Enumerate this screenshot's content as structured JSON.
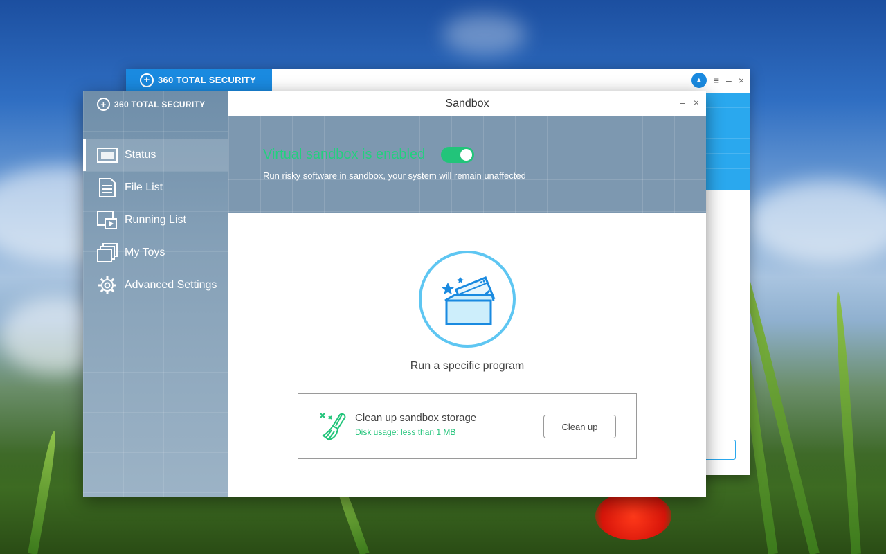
{
  "background_window": {
    "brand": "360 TOTAL SECURITY",
    "controls": {
      "menu": "≡",
      "minimize": "–",
      "close": "×"
    }
  },
  "sandbox_window": {
    "brand": "360 TOTAL SECURITY",
    "title": "Sandbox",
    "controls": {
      "minimize": "–",
      "close": "×"
    }
  },
  "sidebar": {
    "items": [
      {
        "label": "Status",
        "icon": "status-icon",
        "active": true
      },
      {
        "label": "File List",
        "icon": "file-list-icon",
        "active": false
      },
      {
        "label": "Running List",
        "icon": "running-list-icon",
        "active": false
      },
      {
        "label": "My Toys",
        "icon": "my-toys-icon",
        "active": false
      },
      {
        "label": "Advanced Settings",
        "icon": "gear-icon",
        "active": false
      }
    ]
  },
  "banner": {
    "title": "Virtual sandbox is enabled",
    "toggle_on": true,
    "subtitle": "Run risky software in sandbox, your system will remain unaffected"
  },
  "program": {
    "label": "Run a specific program",
    "icon": "sandbox-box-icon"
  },
  "cleanup": {
    "title": "Clean up sandbox storage",
    "usage": "Disk usage: less than 1 MB",
    "button": "Clean up",
    "icon": "broom-icon"
  },
  "colors": {
    "accent_green": "#22c47a",
    "brand_blue": "#1a8ae0",
    "icon_blue": "#5ec6f2",
    "sidebar": "#7f9bb3"
  }
}
